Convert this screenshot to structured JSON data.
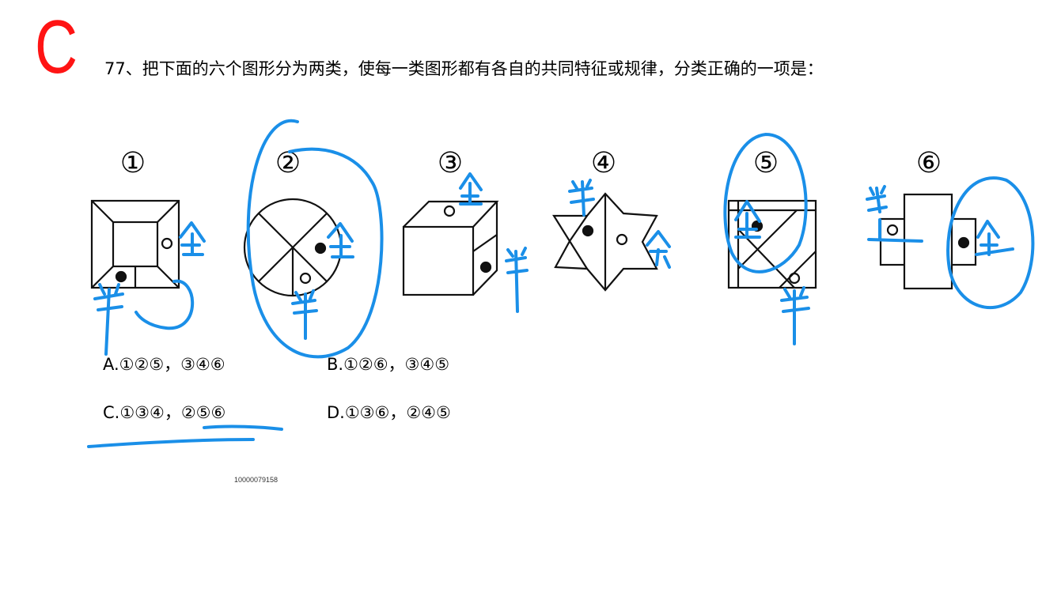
{
  "answer": {
    "letter": "C",
    "color": "#ff1414"
  },
  "question": {
    "text": "77、把下面的六个图形分为两类，使每一类图形都有各自的共同特征或规律，分类正确的一项是："
  },
  "figures": [
    {
      "label": "①"
    },
    {
      "label": "②"
    },
    {
      "label": "③"
    },
    {
      "label": "④"
    },
    {
      "label": "⑤"
    },
    {
      "label": "⑥"
    }
  ],
  "options": [
    {
      "text": "A.①②⑤，③④⑥"
    },
    {
      "text": "B.①②⑥，③④⑤"
    },
    {
      "text": "C.①③④，②⑤⑥"
    },
    {
      "text": "D.①③⑥，②④⑤"
    }
  ],
  "footer": {
    "id": "10000079158"
  },
  "annotation_color": "#1a8fe8"
}
